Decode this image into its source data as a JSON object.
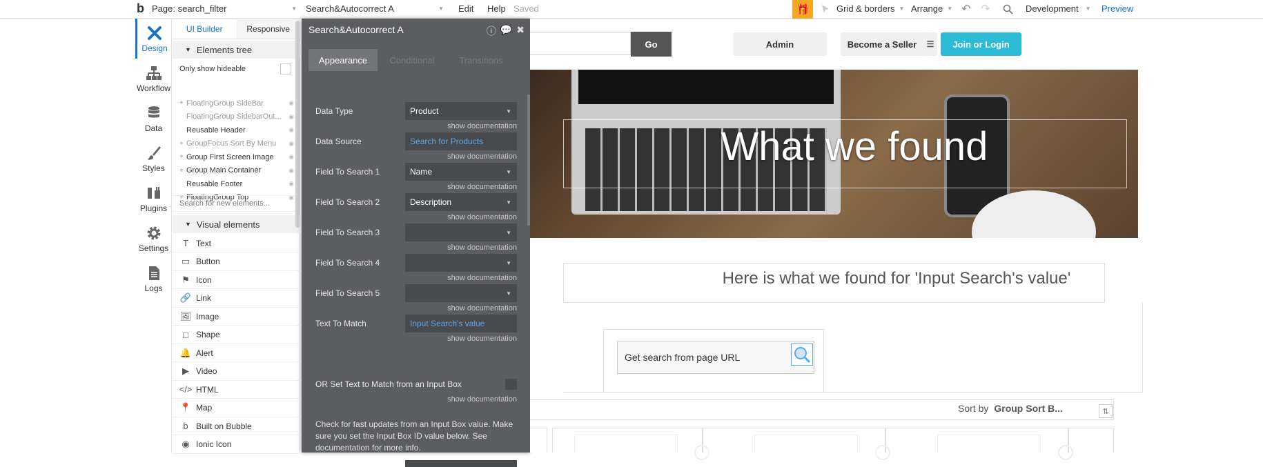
{
  "topbar": {
    "page_label": "Page: search_filter",
    "element_label": "Search&Autocorrect A",
    "menu_edit": "Edit",
    "menu_help": "Help",
    "saved": "Saved",
    "grid": "Grid & borders",
    "arrange": "Arrange",
    "env": "Development",
    "preview": "Preview"
  },
  "leftbar": {
    "design": "Design",
    "workflow": "Workflow",
    "data": "Data",
    "styles": "Styles",
    "plugins": "Plugins",
    "settings": "Settings",
    "logs": "Logs"
  },
  "panel": {
    "tab_ui": "UI Builder",
    "tab_resp": "Responsive",
    "elements_tree": "Elements tree",
    "only_hideable": "Only show hideable",
    "tree": [
      {
        "label": "FloatingGroup SideBar",
        "dim": true,
        "plus": true
      },
      {
        "label": "FloatingGroup SidebarOut...",
        "dim": true,
        "plus": false
      },
      {
        "label": "Reusable Header",
        "dim": false,
        "plus": false
      },
      {
        "label": "GroupFocus Sort By Menu",
        "dim": true,
        "plus": true
      },
      {
        "label": "Group First Screen Image",
        "dim": false,
        "plus": true
      },
      {
        "label": "Group Main Container",
        "dim": false,
        "plus": true
      },
      {
        "label": "Reusable Footer",
        "dim": false,
        "plus": false
      },
      {
        "label": "FloatingGroup Top",
        "dim": false,
        "plus": true
      }
    ],
    "search_placeholder": "Search for new elements...",
    "visual_elements": "Visual elements",
    "visual": [
      "Text",
      "Button",
      "Icon",
      "Link",
      "Image",
      "Shape",
      "Alert",
      "Video",
      "HTML",
      "Map",
      "Built on Bubble",
      "Ionic Icon"
    ],
    "visual_icons": [
      "T",
      "quick",
      "flag",
      "link",
      "image",
      "shape",
      "bell",
      "video",
      "</>",
      "pin",
      "b",
      "ionic"
    ]
  },
  "prop": {
    "title": "Search&Autocorrect A",
    "tab_appearance": "Appearance",
    "tab_conditional": "Conditional",
    "tab_transitions": "Transitions",
    "show_doc": "show documentation",
    "rows": [
      {
        "label": "Data Type",
        "value": "Product",
        "link": false,
        "dd": true
      },
      {
        "label": "Data Source",
        "value": "Search for Products",
        "link": true,
        "dd": false
      },
      {
        "label": "Field To Search 1",
        "value": "Name",
        "link": false,
        "dd": true
      },
      {
        "label": "Field To Search 2",
        "value": "Description",
        "link": false,
        "dd": true
      },
      {
        "label": "Field To Search 3",
        "value": "",
        "link": false,
        "dd": true
      },
      {
        "label": "Field To Search 4",
        "value": "",
        "link": false,
        "dd": true
      },
      {
        "label": "Field To Search 5",
        "value": "",
        "link": false,
        "dd": true
      },
      {
        "label": "Text To Match",
        "value": "Input Search's value",
        "link": true,
        "dd": false
      }
    ],
    "or_label": "OR Set Text to Match from an Input Box",
    "note": "Check for fast updates from an Input Box value. Make sure you set the Input Box ID value below. See documentation for more info."
  },
  "page": {
    "go": "Go",
    "admin": "Admin",
    "seller": "Become a Seller",
    "join": "Join or Login",
    "hero_title": "What we found",
    "result_text": "Here is what we found for 'Input Search's value'",
    "url_text": "Get search from page URL",
    "sort_by": "Sort by",
    "sort_value": "Group Sort B..."
  },
  "colors": {
    "accent": "#1a73c6",
    "join_btn": "#2cbbd6",
    "prop_bg": "#5c5d60",
    "gift": "#f5a623"
  }
}
